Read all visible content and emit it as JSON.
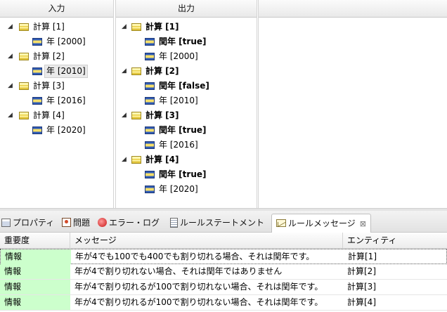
{
  "input_panel": {
    "header": "入力",
    "items": [
      {
        "label": "計算 [1]",
        "year": "年 [2000]"
      },
      {
        "label": "計算 [2]",
        "year": "年 [2010]"
      },
      {
        "label": "計算 [3]",
        "year": "年 [2016]"
      },
      {
        "label": "計算 [4]",
        "year": "年 [2020]"
      }
    ]
  },
  "output_panel": {
    "header": "出力",
    "items": [
      {
        "label": "計算 [1]",
        "leap": "閏年 [true]",
        "year": "年 [2000]"
      },
      {
        "label": "計算 [2]",
        "leap": "閏年 [false]",
        "year": "年 [2010]"
      },
      {
        "label": "計算 [3]",
        "leap": "閏年 [true]",
        "year": "年 [2016]"
      },
      {
        "label": "計算 [4]",
        "leap": "閏年 [true]",
        "year": "年 [2020]"
      }
    ]
  },
  "tabs": [
    {
      "label": "プロパティ",
      "icon": "properties-icon"
    },
    {
      "label": "問題",
      "icon": "problems-icon"
    },
    {
      "label": "エラー・ログ",
      "icon": "error-log-icon"
    },
    {
      "label": "ルールステートメント",
      "icon": "rule-statement-icon"
    },
    {
      "label": "ルールメッセージ",
      "icon": "rule-message-icon",
      "close": "⊠"
    }
  ],
  "table": {
    "columns": [
      "重要度",
      "メッセージ",
      "エンティティ"
    ],
    "rows": [
      {
        "severity": "情報",
        "message": "年が4でも100でも400でも割り切れる場合、それは閏年です。",
        "entity": "計算[1]"
      },
      {
        "severity": "情報",
        "message": "年が4で割り切れない場合、それは閏年ではありません",
        "entity": "計算[2]"
      },
      {
        "severity": "情報",
        "message": "年が4で割り切れるが100で割り切れない場合、それは閏年です。",
        "entity": "計算[3]"
      },
      {
        "severity": "情報",
        "message": "年が4で割り切れるが100で割り切れない場合、それは閏年です。",
        "entity": "計算[4]"
      }
    ]
  },
  "colors": {
    "severity_info_bg": "#ccffcc",
    "tab_active_bg": "#ffffff"
  }
}
